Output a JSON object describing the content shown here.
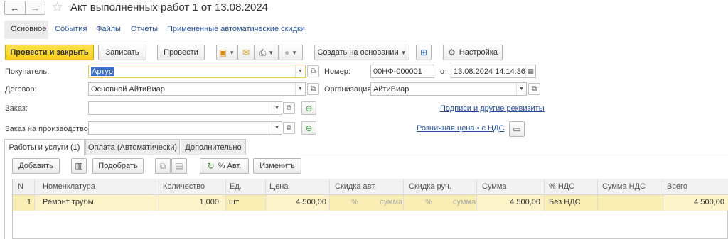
{
  "window": {
    "title": "Акт выполненных работ 1 от 13.08.2024",
    "back_icon": "←",
    "forward_icon": "→",
    "star_icon": "☆"
  },
  "section_tabs": [
    "Основное",
    "События",
    "Файлы",
    "Отчеты",
    "Примененные автоматические скидки"
  ],
  "toolbar": {
    "post_close": "Провести и закрыть",
    "save": "Записать",
    "post": "Провести",
    "create_basis": "Создать на основании",
    "settings": "Настройка"
  },
  "form": {
    "buyer_label": "Покупатель:",
    "buyer_value": "Артур",
    "contract_label": "Договор:",
    "contract_value": "Основной АйтиВиар",
    "order_label": "Заказ:",
    "order_value": "",
    "prod_order_label": "Заказ на производство:",
    "prod_order_value": "",
    "number_label": "Номер:",
    "number_value": "00НФ-000001",
    "from_label": "от:",
    "date_value": "13.08.2024 14:14:36",
    "org_label": "Организация:",
    "org_value": "АйтиВиар",
    "link_signatures": "Подписи и другие реквизиты",
    "link_price": "Розничная цена • с НДС"
  },
  "page_tabs": [
    "Работы и услуги (1)",
    "Оплата (Автоматически)",
    "Дополнительно"
  ],
  "table_toolbar": {
    "add": "Добавить",
    "pick": "Подобрать",
    "auto_pct": "% Авт.",
    "change": "Изменить"
  },
  "table": {
    "columns": [
      "N",
      "Номенклатура",
      "Количество",
      "Ед.",
      "Цена",
      "Скидка авт.",
      "Скидка руч.",
      "Сумма",
      "% НДС",
      "Сумма НДС",
      "Всего"
    ],
    "rows": [
      {
        "n": "1",
        "item": "Ремонт трубы",
        "qty": "1,000",
        "unit": "шт",
        "price": "4 500,00",
        "auto_pct": "%",
        "auto_sum": "сумма",
        "manual_pct": "%",
        "manual_sum": "сумма",
        "sum": "4 500,00",
        "vat_rate": "Без НДС",
        "vat_sum": "",
        "total": "4 500,00"
      }
    ]
  },
  "colors": {
    "accent_yellow": "#f6cf1f",
    "link_blue": "#1f4d9a",
    "row_highlight": "#fbeeb4"
  }
}
